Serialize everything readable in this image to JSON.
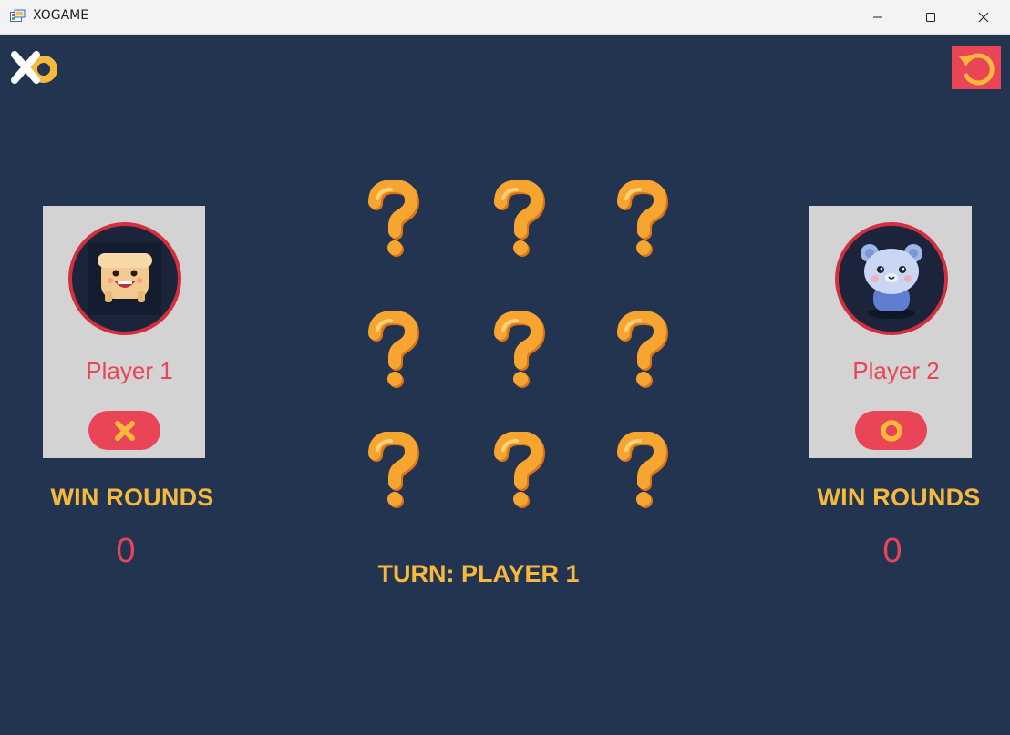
{
  "window": {
    "title": "XOGAME",
    "icon": "winforms-app-icon",
    "controls": [
      "minimize-icon",
      "maximize-icon",
      "close-icon"
    ]
  },
  "colors": {
    "background": "#223450",
    "accent_red": "#e94556",
    "accent_yellow": "#f6b93b",
    "card": "#d3d3d3",
    "question_mark": "#f7a531"
  },
  "header": {
    "logo_icon": "xo-logo",
    "restart_icon": "restart-icon"
  },
  "players": [
    {
      "name": "Player 1",
      "mark": "X",
      "avatar": "toast-character-avatar",
      "win_label": "WIN ROUNDS",
      "wins": "0"
    },
    {
      "name": "Player 2",
      "mark": "O",
      "avatar": "bear-character-avatar",
      "win_label": "WIN ROUNDS",
      "wins": "0"
    }
  ],
  "board": {
    "cells": [
      "?",
      "?",
      "?",
      "?",
      "?",
      "?",
      "?",
      "?",
      "?"
    ],
    "cell_icon": "question-mark-icon"
  },
  "status": {
    "turn_label": "TURN:",
    "turn_player": "PLAYER 1"
  }
}
